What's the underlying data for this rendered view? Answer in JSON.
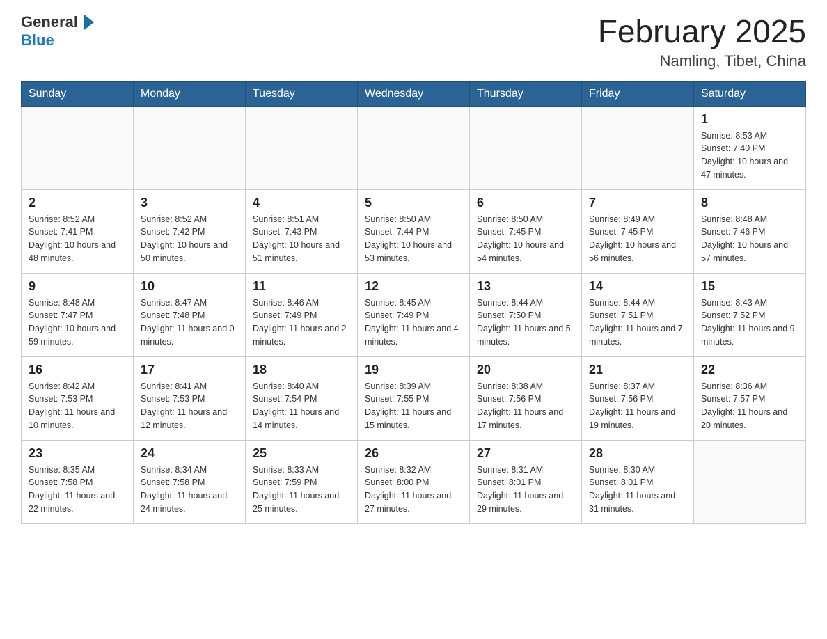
{
  "header": {
    "logo_line1": "General",
    "logo_line2": "Blue",
    "title": "February 2025",
    "subtitle": "Namling, Tibet, China"
  },
  "days_of_week": [
    "Sunday",
    "Monday",
    "Tuesday",
    "Wednesday",
    "Thursday",
    "Friday",
    "Saturday"
  ],
  "weeks": [
    [
      {
        "day": "",
        "info": ""
      },
      {
        "day": "",
        "info": ""
      },
      {
        "day": "",
        "info": ""
      },
      {
        "day": "",
        "info": ""
      },
      {
        "day": "",
        "info": ""
      },
      {
        "day": "",
        "info": ""
      },
      {
        "day": "1",
        "info": "Sunrise: 8:53 AM\nSunset: 7:40 PM\nDaylight: 10 hours and 47 minutes."
      }
    ],
    [
      {
        "day": "2",
        "info": "Sunrise: 8:52 AM\nSunset: 7:41 PM\nDaylight: 10 hours and 48 minutes."
      },
      {
        "day": "3",
        "info": "Sunrise: 8:52 AM\nSunset: 7:42 PM\nDaylight: 10 hours and 50 minutes."
      },
      {
        "day": "4",
        "info": "Sunrise: 8:51 AM\nSunset: 7:43 PM\nDaylight: 10 hours and 51 minutes."
      },
      {
        "day": "5",
        "info": "Sunrise: 8:50 AM\nSunset: 7:44 PM\nDaylight: 10 hours and 53 minutes."
      },
      {
        "day": "6",
        "info": "Sunrise: 8:50 AM\nSunset: 7:45 PM\nDaylight: 10 hours and 54 minutes."
      },
      {
        "day": "7",
        "info": "Sunrise: 8:49 AM\nSunset: 7:45 PM\nDaylight: 10 hours and 56 minutes."
      },
      {
        "day": "8",
        "info": "Sunrise: 8:48 AM\nSunset: 7:46 PM\nDaylight: 10 hours and 57 minutes."
      }
    ],
    [
      {
        "day": "9",
        "info": "Sunrise: 8:48 AM\nSunset: 7:47 PM\nDaylight: 10 hours and 59 minutes."
      },
      {
        "day": "10",
        "info": "Sunrise: 8:47 AM\nSunset: 7:48 PM\nDaylight: 11 hours and 0 minutes."
      },
      {
        "day": "11",
        "info": "Sunrise: 8:46 AM\nSunset: 7:49 PM\nDaylight: 11 hours and 2 minutes."
      },
      {
        "day": "12",
        "info": "Sunrise: 8:45 AM\nSunset: 7:49 PM\nDaylight: 11 hours and 4 minutes."
      },
      {
        "day": "13",
        "info": "Sunrise: 8:44 AM\nSunset: 7:50 PM\nDaylight: 11 hours and 5 minutes."
      },
      {
        "day": "14",
        "info": "Sunrise: 8:44 AM\nSunset: 7:51 PM\nDaylight: 11 hours and 7 minutes."
      },
      {
        "day": "15",
        "info": "Sunrise: 8:43 AM\nSunset: 7:52 PM\nDaylight: 11 hours and 9 minutes."
      }
    ],
    [
      {
        "day": "16",
        "info": "Sunrise: 8:42 AM\nSunset: 7:53 PM\nDaylight: 11 hours and 10 minutes."
      },
      {
        "day": "17",
        "info": "Sunrise: 8:41 AM\nSunset: 7:53 PM\nDaylight: 11 hours and 12 minutes."
      },
      {
        "day": "18",
        "info": "Sunrise: 8:40 AM\nSunset: 7:54 PM\nDaylight: 11 hours and 14 minutes."
      },
      {
        "day": "19",
        "info": "Sunrise: 8:39 AM\nSunset: 7:55 PM\nDaylight: 11 hours and 15 minutes."
      },
      {
        "day": "20",
        "info": "Sunrise: 8:38 AM\nSunset: 7:56 PM\nDaylight: 11 hours and 17 minutes."
      },
      {
        "day": "21",
        "info": "Sunrise: 8:37 AM\nSunset: 7:56 PM\nDaylight: 11 hours and 19 minutes."
      },
      {
        "day": "22",
        "info": "Sunrise: 8:36 AM\nSunset: 7:57 PM\nDaylight: 11 hours and 20 minutes."
      }
    ],
    [
      {
        "day": "23",
        "info": "Sunrise: 8:35 AM\nSunset: 7:58 PM\nDaylight: 11 hours and 22 minutes."
      },
      {
        "day": "24",
        "info": "Sunrise: 8:34 AM\nSunset: 7:58 PM\nDaylight: 11 hours and 24 minutes."
      },
      {
        "day": "25",
        "info": "Sunrise: 8:33 AM\nSunset: 7:59 PM\nDaylight: 11 hours and 25 minutes."
      },
      {
        "day": "26",
        "info": "Sunrise: 8:32 AM\nSunset: 8:00 PM\nDaylight: 11 hours and 27 minutes."
      },
      {
        "day": "27",
        "info": "Sunrise: 8:31 AM\nSunset: 8:01 PM\nDaylight: 11 hours and 29 minutes."
      },
      {
        "day": "28",
        "info": "Sunrise: 8:30 AM\nSunset: 8:01 PM\nDaylight: 11 hours and 31 minutes."
      },
      {
        "day": "",
        "info": ""
      }
    ]
  ]
}
